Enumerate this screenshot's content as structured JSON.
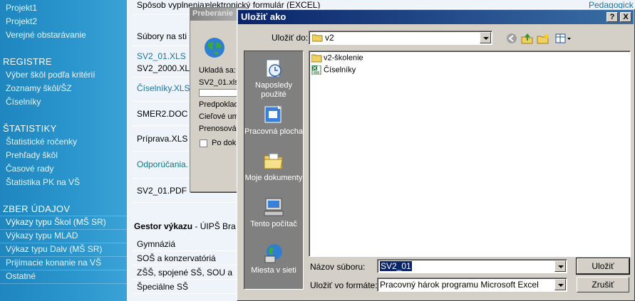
{
  "sidebar": {
    "items_top": [
      "Projekt1",
      "Projekt2",
      "Verejné obstarávanie"
    ],
    "registre": {
      "title": "REGISTRE",
      "items": [
        "Výber škôl podľa kritérií",
        "Zoznamy škôl/ŠZ",
        "Číselníky"
      ]
    },
    "statistiky": {
      "title": "ŠTATISTIKY",
      "items": [
        "Štatistické ročenky",
        "Prehľady škôl",
        "Časové rady",
        "Štatistika PK na VŠ"
      ]
    },
    "zber": {
      "title": "ZBER ÚDAJOV",
      "items": [
        "Výkazy typu Škol (MŠ SR)",
        "Výkazy typu MLAD",
        "Výkaz typu Dalv (MŠ SR)",
        "Prijímacie konanie na VŠ",
        "Ostatné"
      ]
    }
  },
  "page": {
    "sposob_label": "Spôsob vyplnenia:",
    "sposob_value": "elektronický formulár (EXCEL)",
    "subory_label": "Súbory na sti",
    "files": [
      "SV2_01.XLS",
      "SV2_2000.XL",
      "Číselníky.XLS",
      "SMER2.DOC",
      "Príprava.XLS",
      "Odporúčania.",
      "SV2_01.PDF"
    ],
    "ped_link": "Pedagogick",
    "gestor_label": "Gestor výkazu",
    "gestor_value": " - ÚIPŠ Bra",
    "schools": [
      "Gymnáziá",
      "SOŠ a konzervatóriá",
      "ZŠŠ, spojené SŠ, SOU a",
      "Špeciálne SŠ"
    ]
  },
  "progress": {
    "title": "Preberanie",
    "ukladasa": "Ukladá sa:",
    "file": "SV2_01.xls",
    "predpoklad": "Predpoklad",
    "cielove": "Cieľové um",
    "prenosova": "Prenosová",
    "podok": "Po dok"
  },
  "dialog": {
    "title": "Uložiť ako",
    "help": "?",
    "close": "X",
    "ulozit_do_label": "Uložiť do:",
    "ulozit_do_value": "v2",
    "places": [
      "Naposledy použité",
      "Pracovná plocha",
      "Moje dokumenty",
      "Tento počítač",
      "Miesta v sieti"
    ],
    "files": [
      {
        "name": "v2-školenie",
        "icon": "folder-icon"
      },
      {
        "name": "Číselníky",
        "icon": "excel-file-icon"
      }
    ],
    "nazov_label": "Názov súboru:",
    "nazov_value": "SV2_01",
    "format_label": "Uložiť vo formáte:",
    "format_value": "Pracovný hárok programu Microsoft Excel",
    "save_button": "Uložiť",
    "cancel_button": "Zrušiť"
  }
}
